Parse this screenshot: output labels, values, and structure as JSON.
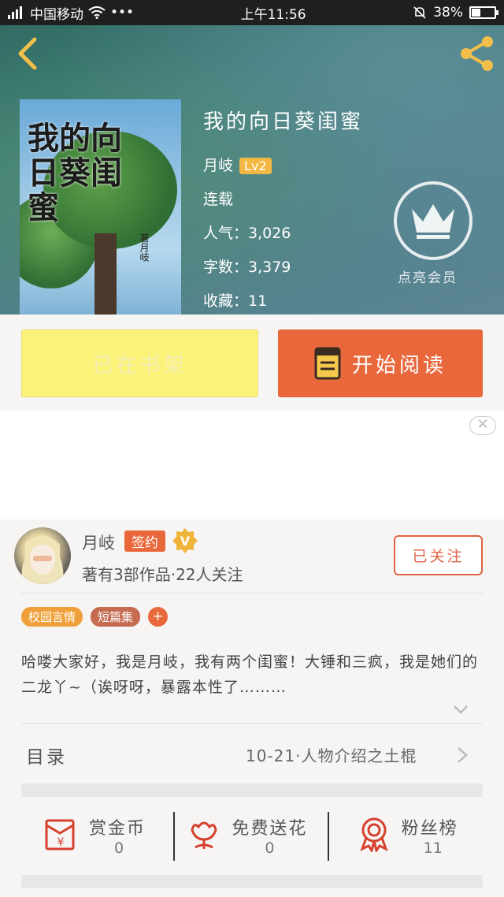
{
  "status_bar": {
    "carrier": "中国移动",
    "dots": "•••",
    "time": "上午11:56",
    "battery": "38%"
  },
  "book": {
    "title": "我的向日葵闺蜜",
    "author": "月岐",
    "level": "Lv2",
    "state": "连载",
    "popularity": "人气：3,026",
    "words": "字数：3,379",
    "favorites": "收藏：11",
    "cover_title": "我的向日葵闺蜜",
    "cover_author": "著月岐"
  },
  "vip": {
    "label": "点亮会员"
  },
  "buttons": {
    "shelf": "已在书架",
    "read": "开始阅读"
  },
  "ad": {
    "close": "✕"
  },
  "author": {
    "name": "月岐",
    "sign": "签约",
    "v": "V",
    "stats": "著有3部作品·22人关注",
    "follow": "已关注"
  },
  "tags": [
    {
      "label": "校园言情",
      "color": "#f0a03a"
    },
    {
      "label": "短篇集",
      "color": "#c56b4f"
    }
  ],
  "tag_add": "+",
  "intro": "哈喽大家好，我是月岐，我有两个闺蜜！大锤和三疯，我是她们的二龙丫~（诶呀呀，暴露本性了………",
  "toc": {
    "label": "目录",
    "latest": "10-21·人物介绍之土棍"
  },
  "actions": [
    {
      "label": "赏金币",
      "count": "0",
      "icon": "money-envelope-icon"
    },
    {
      "label": "免费送花",
      "count": "0",
      "icon": "flower-icon"
    },
    {
      "label": "粉丝榜",
      "count": "11",
      "icon": "medal-icon"
    }
  ],
  "colors": {
    "accent": "#e9683b",
    "shelf": "#fbf27a",
    "header": "#3e7d7a"
  }
}
